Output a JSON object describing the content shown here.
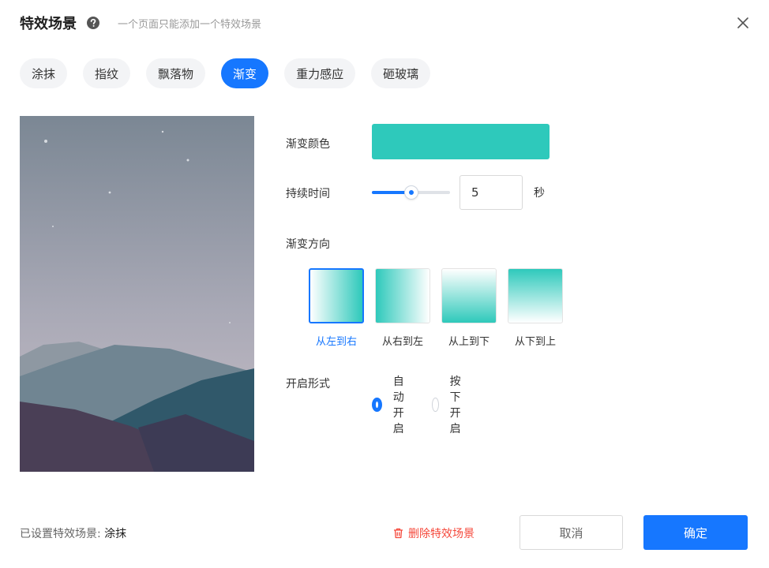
{
  "dialog": {
    "title": "特效场景",
    "subtitle": "一个页面只能添加一个特效场景"
  },
  "tabs": [
    {
      "label": "涂抹",
      "active": false
    },
    {
      "label": "指纹",
      "active": false
    },
    {
      "label": "飘落物",
      "active": false
    },
    {
      "label": "渐变",
      "active": true
    },
    {
      "label": "重力感应",
      "active": false
    },
    {
      "label": "砸玻璃",
      "active": false
    }
  ],
  "form": {
    "gradient_color_label": "渐变颜色",
    "gradient_color": "#2ec9bb",
    "duration_label": "持续时间",
    "duration_value": "5",
    "duration_slider_fraction": 0.5,
    "duration_unit": "秒",
    "direction_label": "渐变方向",
    "directions": [
      {
        "label": "从左到右",
        "selected": true
      },
      {
        "label": "从右到左",
        "selected": false
      },
      {
        "label": "从上到下",
        "selected": false
      },
      {
        "label": "从下到上",
        "selected": false
      }
    ],
    "trigger_label": "开启形式",
    "trigger_options": [
      {
        "label": "自动开启",
        "checked": true
      },
      {
        "label": "按下开启",
        "checked": false
      }
    ]
  },
  "footer": {
    "status_label": "已设置特效场景: ",
    "status_value": "涂抹",
    "delete_label": "删除特效场景",
    "cancel_label": "取消",
    "confirm_label": "确定"
  },
  "colors": {
    "accent": "#1677ff",
    "danger": "#f5483b",
    "gradient": "#2ec9bb"
  },
  "icons": {
    "help": "help-icon",
    "close": "close-icon",
    "delete": "trash-icon"
  }
}
